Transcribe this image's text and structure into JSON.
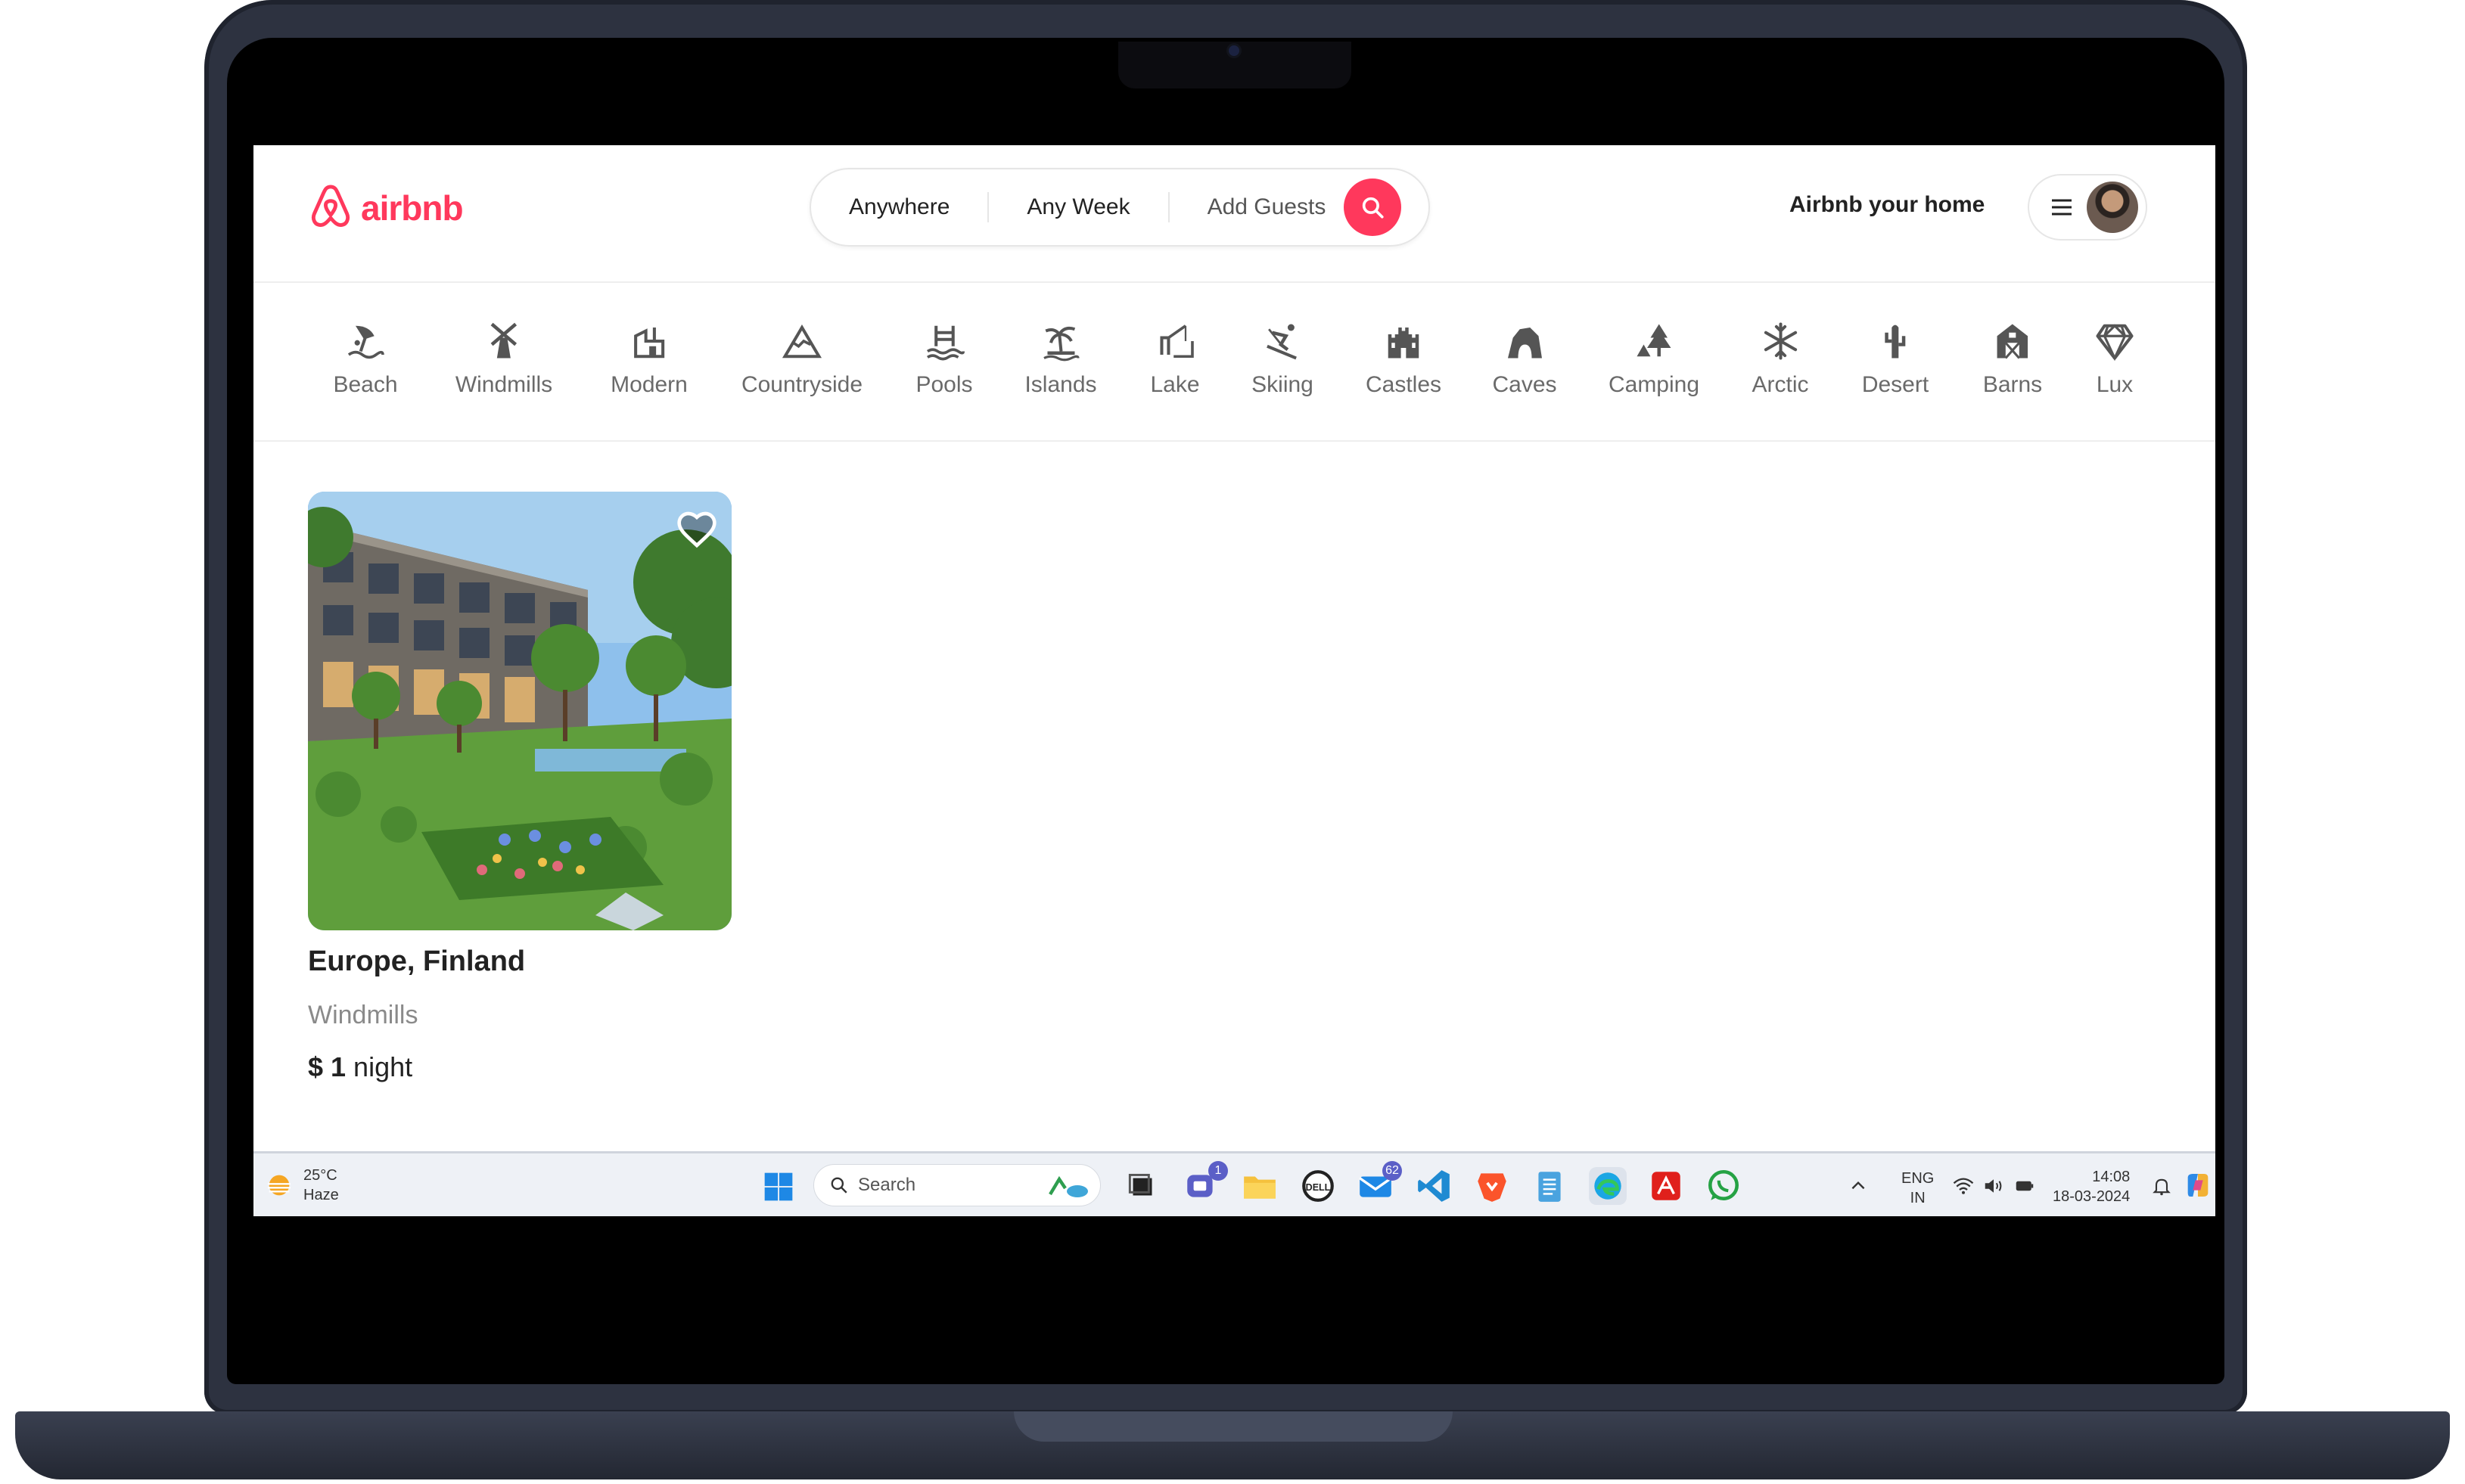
{
  "header": {
    "logo_text": "airbnb",
    "search": {
      "where": "Anywhere",
      "when": "Any Week",
      "who": "Add Guests"
    },
    "host_link": "Airbnb your home"
  },
  "categories": [
    {
      "label": "Beach",
      "icon": "beach-icon"
    },
    {
      "label": "Windmills",
      "icon": "windmill-icon"
    },
    {
      "label": "Modern",
      "icon": "modern-house-icon"
    },
    {
      "label": "Countryside",
      "icon": "mountain-icon"
    },
    {
      "label": "Pools",
      "icon": "pool-icon"
    },
    {
      "label": "Islands",
      "icon": "island-icon"
    },
    {
      "label": "Lake",
      "icon": "lake-icon"
    },
    {
      "label": "Skiing",
      "icon": "skiing-icon"
    },
    {
      "label": "Castles",
      "icon": "castle-icon"
    },
    {
      "label": "Caves",
      "icon": "cave-icon"
    },
    {
      "label": "Camping",
      "icon": "camping-icon"
    },
    {
      "label": "Arctic",
      "icon": "snowflake-icon"
    },
    {
      "label": "Desert",
      "icon": "cactus-icon"
    },
    {
      "label": "Barns",
      "icon": "barn-icon"
    },
    {
      "label": "Lux",
      "icon": "diamond-icon"
    }
  ],
  "listing": {
    "location": "Europe, Finland",
    "category": "Windmills",
    "price_amount": "$ 1",
    "price_unit": " night"
  },
  "taskbar": {
    "weather_temp": "25°C",
    "weather_desc": "Haze",
    "search_placeholder": "Search",
    "teams_badge": "1",
    "mail_badge": "62",
    "lang_top": "ENG",
    "lang_bottom": "IN",
    "time": "14:08",
    "date": "18-03-2024"
  },
  "colors": {
    "brand": "#ff385c",
    "text_primary": "#222222",
    "text_secondary": "#6a6a6a"
  }
}
